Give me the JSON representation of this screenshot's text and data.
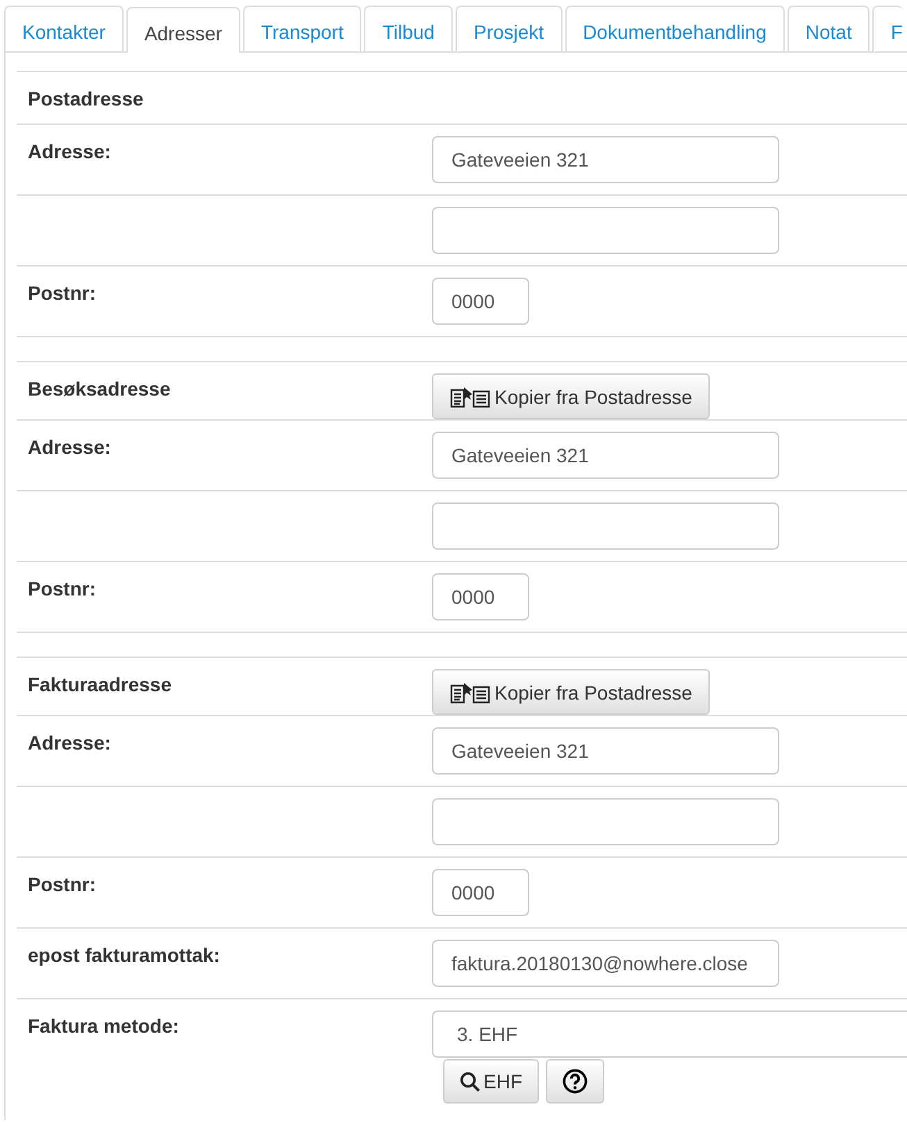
{
  "tabs": [
    {
      "label": "Kontakter",
      "selected": false
    },
    {
      "label": "Adresser",
      "selected": true
    },
    {
      "label": "Transport",
      "selected": false
    },
    {
      "label": "Tilbud",
      "selected": false
    },
    {
      "label": "Prosjekt",
      "selected": false
    },
    {
      "label": "Dokumentbehandling",
      "selected": false
    },
    {
      "label": "Notat",
      "selected": false
    },
    {
      "label": "F",
      "selected": false
    }
  ],
  "sections": [
    {
      "title": "Postadresse",
      "fields": [
        {
          "label": "Adresse:",
          "kind": "text",
          "value": "Gateveeien 321"
        },
        {
          "kind": "text"
        },
        {
          "label": "Postnr:",
          "kind": "short",
          "value": "0000"
        }
      ]
    },
    {
      "title": "Besøksadresse",
      "action": "Kopier fra Postadresse",
      "fields": [
        {
          "label": "Adresse:",
          "kind": "text",
          "value": "Gateveeien 321"
        },
        {
          "kind": "text"
        },
        {
          "label": "Postnr:",
          "kind": "short",
          "value": "0000"
        }
      ]
    },
    {
      "title": "Fakturaadresse",
      "action": "Kopier fra Postadresse",
      "fields": [
        {
          "label": "Adresse:",
          "kind": "text",
          "value": "Gateveeien 321"
        },
        {
          "kind": "text"
        },
        {
          "label": "Postnr:",
          "kind": "short",
          "value": "0000"
        },
        {
          "label": "epost fakturamottak:",
          "kind": "text",
          "value": "faktura.20180130@nowhere.close"
        },
        {
          "label": "Faktura metode:",
          "kind": "select",
          "value": "3. EHF",
          "buttons": [
            {
              "kind": "search",
              "label": "EHF"
            },
            {
              "kind": "help"
            }
          ]
        }
      ]
    }
  ]
}
